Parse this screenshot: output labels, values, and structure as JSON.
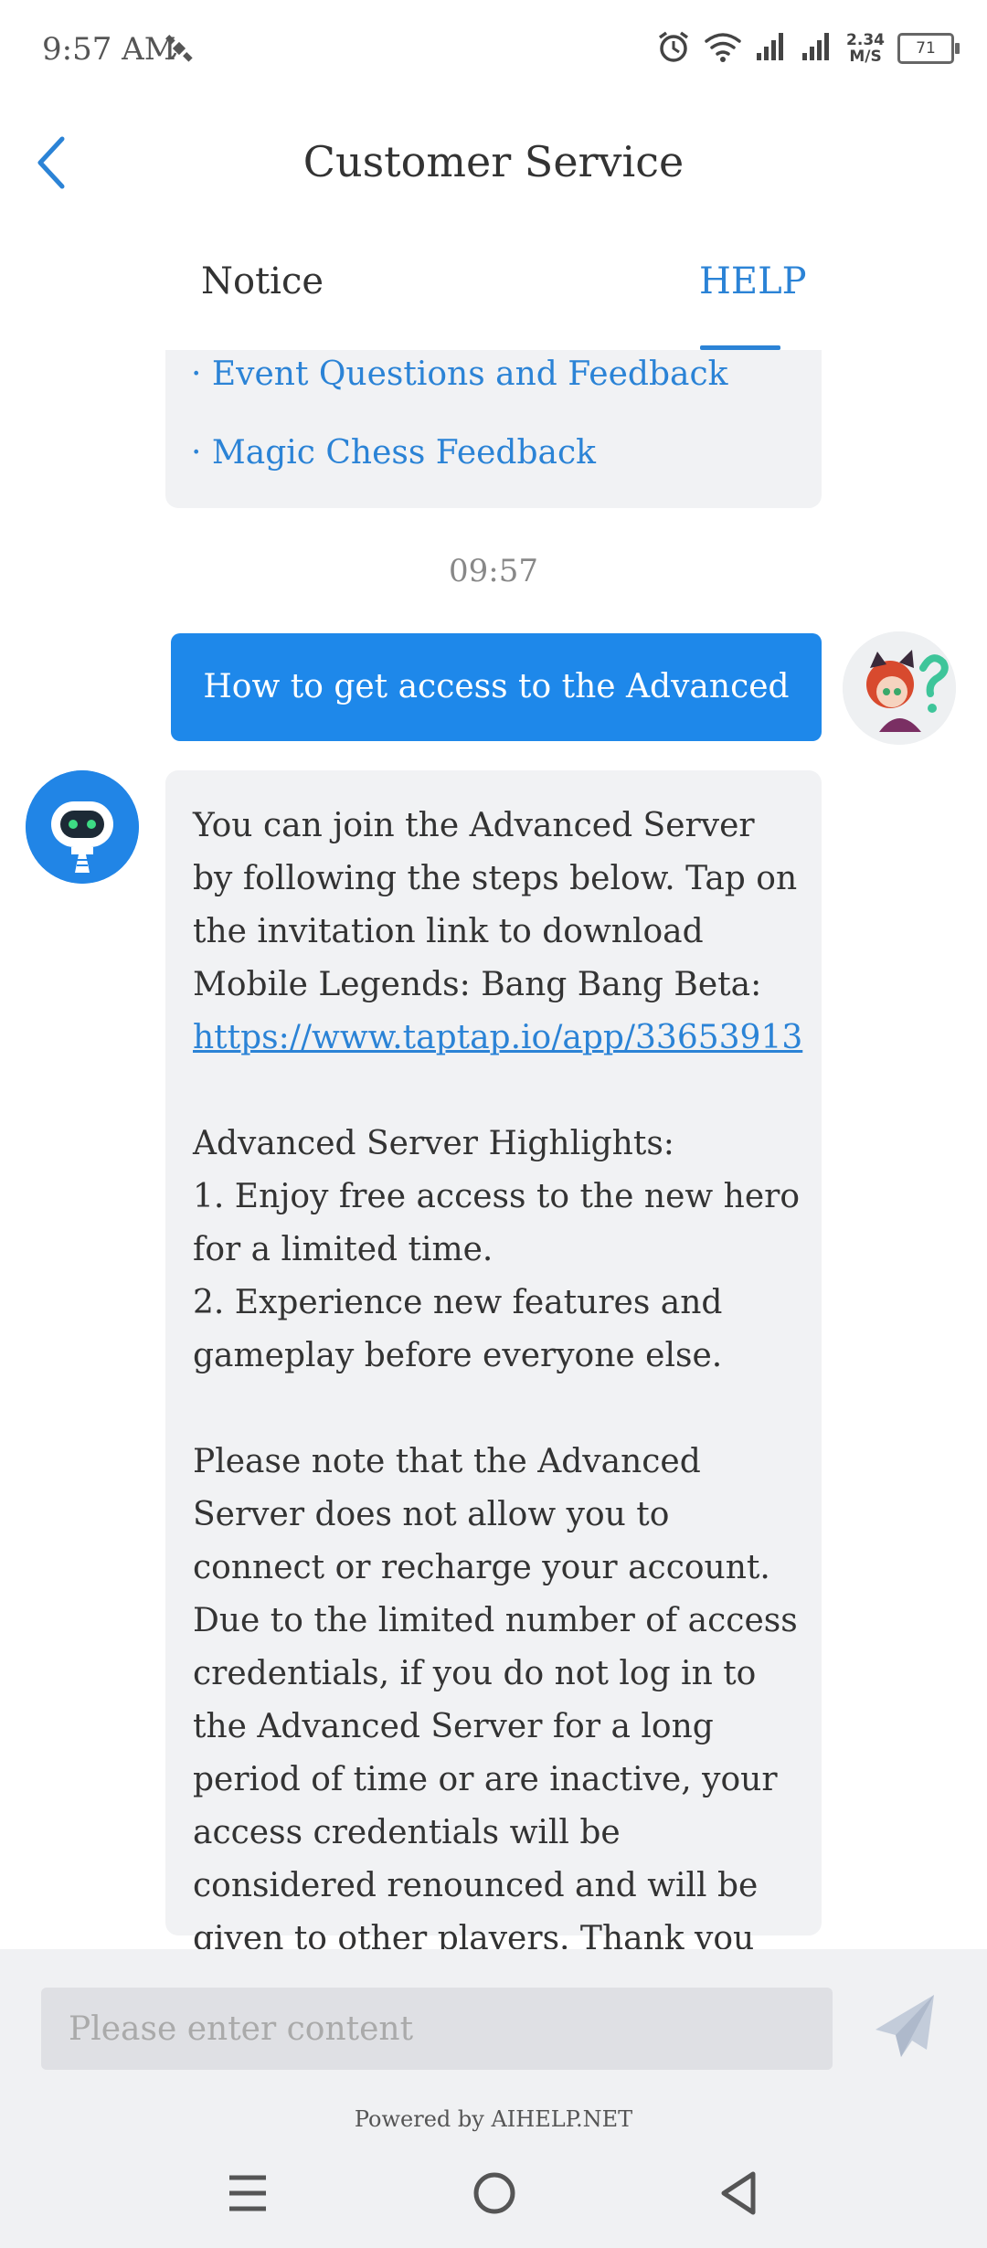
{
  "status": {
    "time": "9:57 AM",
    "speed_value": "2.34",
    "speed_unit": "M/S",
    "battery": "71"
  },
  "header": {
    "title": "Customer Service"
  },
  "tabs": [
    {
      "label": "Notice",
      "active": false
    },
    {
      "label": "HELP",
      "active": true
    }
  ],
  "chat": {
    "faq_links": [
      "· Event Questions and Feedback",
      "· Magic Chess Feedback"
    ],
    "timestamp": "09:57",
    "user_message": "How to get access to the Advanced Server?",
    "bot_message": {
      "intro": "You can join the Advanced Server by following the steps below. Tap on the invitation link to download Mobile Legends: Bang Bang Beta: ",
      "link": "https://www.taptap.io/app/33653913",
      "body": "\n\nAdvanced Server Highlights:\n1. Enjoy free access to the new hero for a limited time.\n2. Experience new features and gameplay before everyone else.\n\nPlease note that the Advanced Server does not allow you to connect or recharge your account. Due to the limited number of access credentials, if you do not log in to the Advanced Server for a long period of time or are inactive, your access credentials will be considered renounced and will be given to other players. Thank you for your understanding!"
    }
  },
  "input": {
    "placeholder": "Please enter content",
    "value": ""
  },
  "footer": {
    "powered_by": "Powered by AIHELP.NET"
  },
  "colors": {
    "accent": "#2b83d6",
    "user_bubble": "#1e88ea",
    "bubble_bg": "#f1f2f4"
  },
  "icons": {
    "back": "chevron-left-icon",
    "send": "send-icon",
    "nav": [
      "menu-icon",
      "home-icon",
      "back-triangle-icon"
    ]
  }
}
